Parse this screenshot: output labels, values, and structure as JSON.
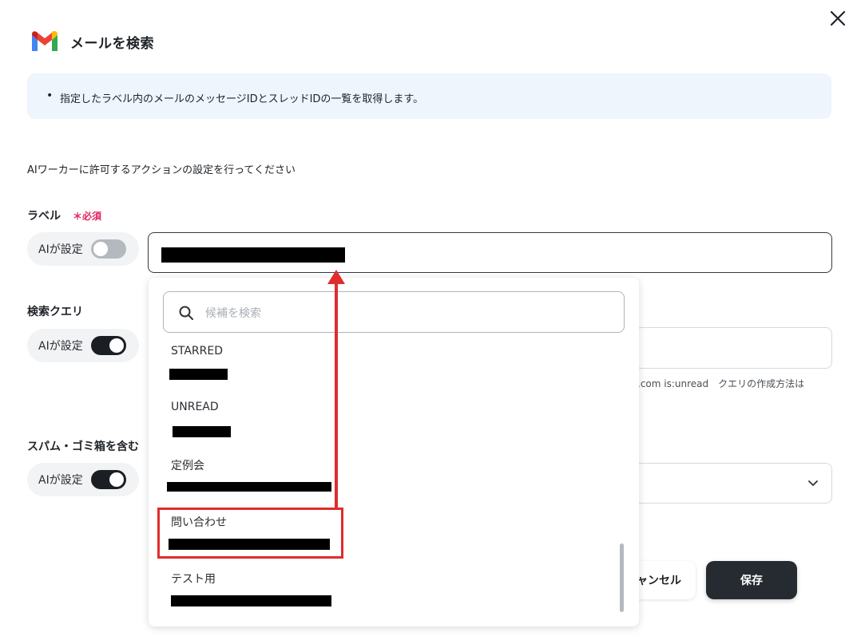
{
  "modal": {
    "title": "メールを検索",
    "close_icon": "close-icon",
    "logo": "gmail-logo"
  },
  "info": {
    "bullet": "•",
    "text": "指定したラベル内のメールのメッセージIDとスレッドIDの一覧を取得します。"
  },
  "intro": "AIワーカーに許可するアクションの設定を行ってください",
  "fields": {
    "label": {
      "heading": "ラベル",
      "required": "＊必須",
      "ai_toggle_label": "AIが設定",
      "ai_toggle_on": false
    },
    "query": {
      "heading": "検索クエリ",
      "ai_toggle_label": "AIが設定",
      "ai_toggle_on": true,
      "hint": ".com is:unread　クエリの作成方法は"
    },
    "spam": {
      "heading": "スパム・ゴミ箱を含む",
      "ai_toggle_label": "AIが設定",
      "ai_toggle_on": true
    }
  },
  "dropdown": {
    "search_placeholder": "候補を検索",
    "items": [
      {
        "name": "STARRED"
      },
      {
        "name": "UNREAD"
      },
      {
        "name": "定例会"
      },
      {
        "name": "問い合わせ",
        "highlighted": true
      },
      {
        "name": "テスト用"
      }
    ]
  },
  "buttons": {
    "cancel": "ャンセル",
    "save": "保存"
  },
  "colors": {
    "accent_dark": "#262b31",
    "annotation_red": "#e02c2c",
    "required_red": "#e0245e",
    "info_bg": "#eef5fd"
  }
}
